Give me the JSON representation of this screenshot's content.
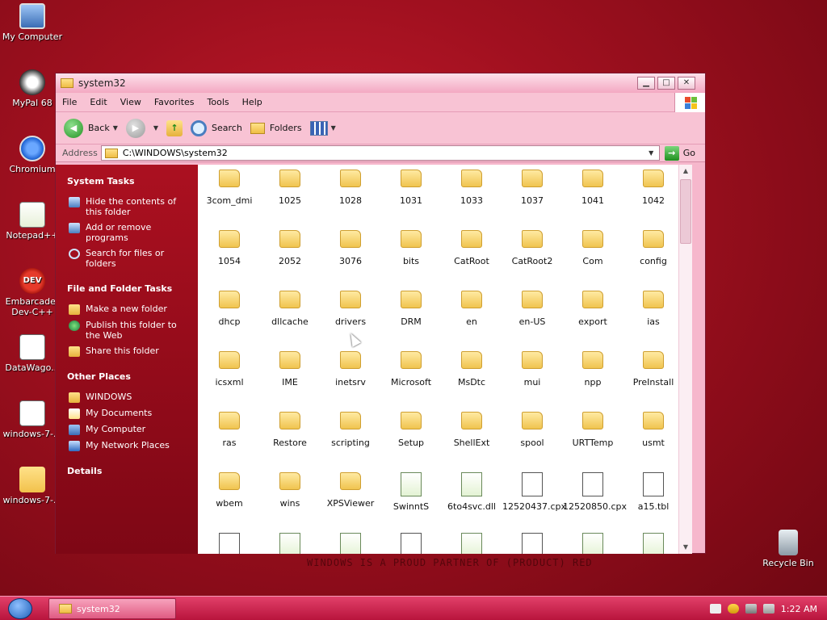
{
  "desktop": {
    "icons": [
      {
        "label": "My Computer",
        "icon": "computer-icon"
      },
      {
        "label": "MyPal 68",
        "icon": "mypal-icon"
      },
      {
        "label": "Chromium",
        "icon": "chromium-icon"
      },
      {
        "label": "Notepad++",
        "icon": "notepad-icon"
      },
      {
        "label": "Embarcader Dev-C++",
        "icon": "devcpp-icon"
      },
      {
        "label": "DataWago...",
        "icon": "file-icon"
      },
      {
        "label": "windows-7-...",
        "icon": "file-icon"
      },
      {
        "label": "windows-7-...",
        "icon": "folder-icon"
      },
      {
        "label": "Recycle Bin",
        "icon": "recycle-bin-icon"
      }
    ],
    "watermark": "WINDOWS IS A PROUD PARTNER OF (PRODUCT) RED"
  },
  "window": {
    "title": "system32",
    "menu": [
      "File",
      "Edit",
      "View",
      "Favorites",
      "Tools",
      "Help"
    ],
    "toolbar": {
      "back": "Back",
      "search": "Search",
      "folders": "Folders"
    },
    "address": {
      "label": "Address",
      "value": "C:\\WINDOWS\\system32",
      "go": "Go"
    },
    "taskpane": {
      "system_tasks": {
        "title": "System Tasks",
        "items": [
          "Hide the contents of this folder",
          "Add or remove programs",
          "Search for files or folders"
        ]
      },
      "file_tasks": {
        "title": "File and Folder Tasks",
        "items": [
          "Make a new folder",
          "Publish this folder to the Web",
          "Share this folder"
        ]
      },
      "other_places": {
        "title": "Other Places",
        "items": [
          "WINDOWS",
          "My Documents",
          "My Computer",
          "My Network Places"
        ]
      },
      "details": {
        "title": "Details"
      }
    },
    "files": [
      "3com_dmi",
      "1025",
      "1028",
      "1031",
      "1033",
      "1037",
      "1041",
      "1042",
      "1054",
      "2052",
      "3076",
      "bits",
      "CatRoot",
      "CatRoot2",
      "Com",
      "config",
      "dhcp",
      "dllcache",
      "drivers",
      "DRM",
      "en",
      "en-US",
      "export",
      "ias",
      "icsxml",
      "IME",
      "inetsrv",
      "Microsoft",
      "MsDtc",
      "mui",
      "npp",
      "PreInstall",
      "ras",
      "Restore",
      "scripting",
      "Setup",
      "ShellExt",
      "spool",
      "URTTemp",
      "usmt",
      "wbem",
      "wins",
      "XPSViewer",
      "SwinntS",
      "6to4svc.dll",
      "12520437.cpx",
      "12520850.cpx",
      "a15.tbl"
    ]
  },
  "taskbar": {
    "task": "system32",
    "time": "1:22 AM"
  }
}
